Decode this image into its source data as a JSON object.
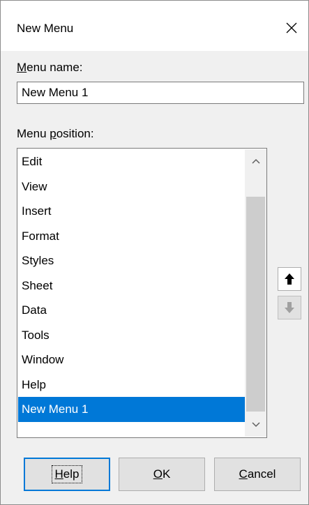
{
  "window": {
    "title": "New Menu",
    "close_icon": "close-icon"
  },
  "menu_name": {
    "label_accel": "M",
    "label_rest": "enu name:",
    "value": "New Menu 1"
  },
  "menu_position": {
    "label_pre": "Menu ",
    "label_accel": "p",
    "label_rest": "osition:",
    "items": [
      "Edit",
      "View",
      "Insert",
      "Format",
      "Styles",
      "Sheet",
      "Data",
      "Tools",
      "Window",
      "Help",
      "New Menu 1"
    ],
    "selected": "New Menu 1"
  },
  "move": {
    "up_icon": "arrow-up-icon",
    "down_icon": "arrow-down-icon"
  },
  "buttons": {
    "help_accel": "H",
    "help_rest": "elp",
    "ok_accel": "O",
    "ok_rest": "K",
    "cancel_accel": "C",
    "cancel_rest": "ancel"
  },
  "colors": {
    "selection": "#0078d7",
    "dialog_bg": "#f0f0f0"
  }
}
